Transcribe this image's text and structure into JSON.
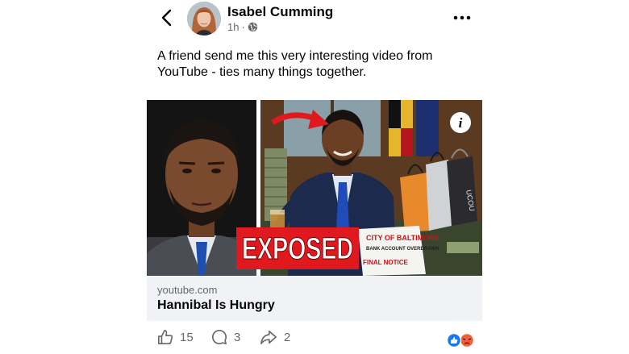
{
  "post": {
    "author": "Isabel Cumming",
    "time": "1h",
    "separator": "·",
    "text": "A friend send me this very interesting video from YouTube - ties many things together."
  },
  "link_card": {
    "domain": "youtube.com",
    "title": "Hannibal Is Hungry",
    "thumbnail": {
      "banner_text": "EXPOSED",
      "notice_lines": [
        "CITY OF BALTIMORE",
        "BANK ACCOUNT OVERDRAWN",
        "FINAL NOTICE"
      ],
      "bag_text": "UCOU",
      "info_symbol": "i"
    }
  },
  "actions": {
    "likes": "15",
    "comments": "3",
    "shares": "2"
  },
  "icons": {
    "back": "chevron-left-icon",
    "globe": "globe-icon",
    "more": "more-horizontal-icon",
    "like": "thumbs-up-icon",
    "comment": "comment-icon",
    "share": "share-icon",
    "info": "info-icon",
    "reaction_like": "like-reaction-icon",
    "reaction_angry": "angry-reaction-icon"
  },
  "colors": {
    "text": "#050505",
    "secondary": "#65676b",
    "card_bg": "#f0f2f5",
    "banner_red": "#e0191f",
    "like_blue": "#1877f2",
    "angry_orange": "#f0613a"
  }
}
